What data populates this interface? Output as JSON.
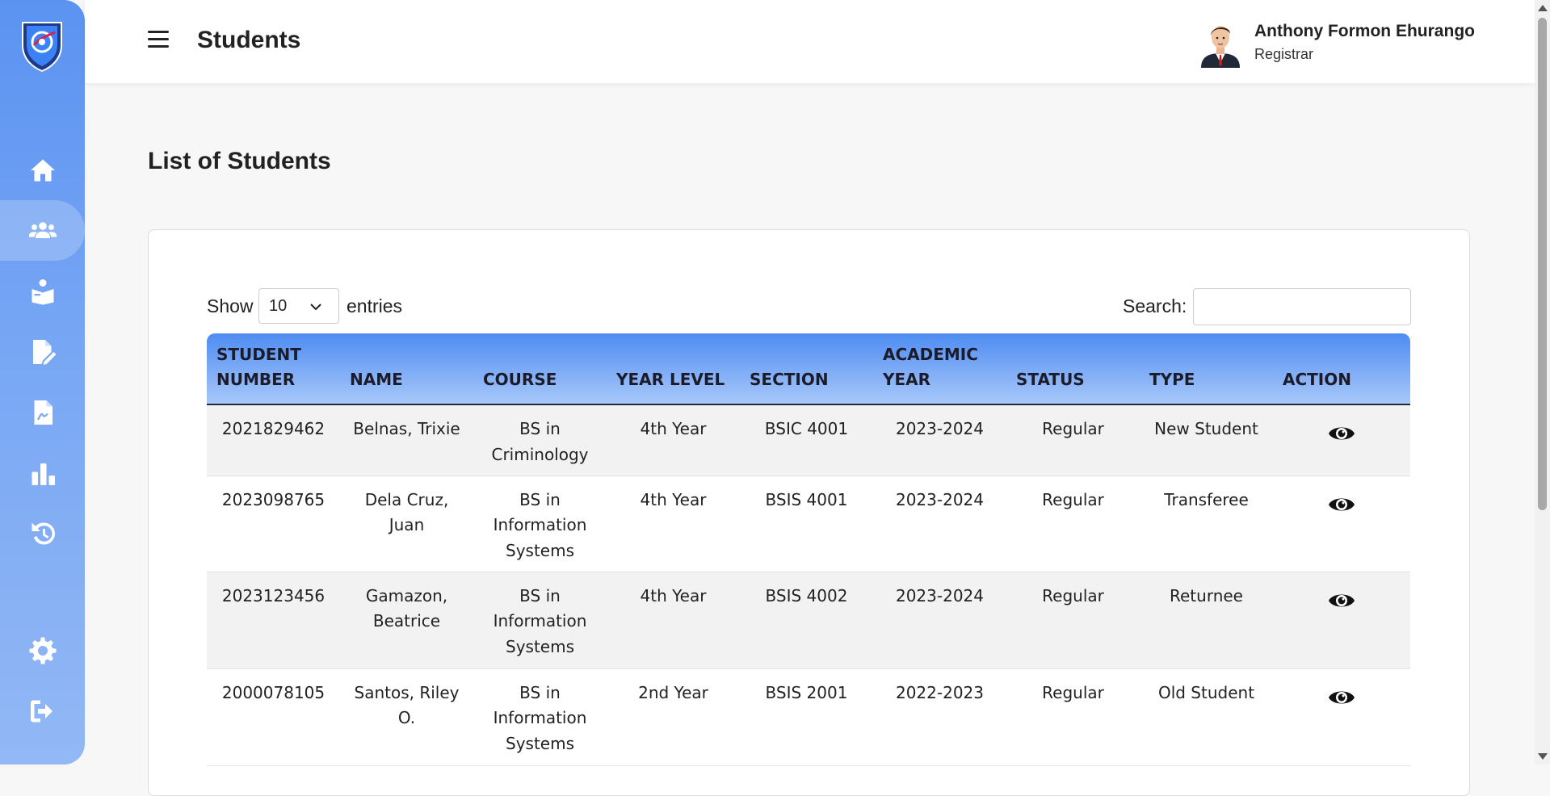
{
  "header": {
    "title": "Students",
    "user_name": "Anthony Formon Ehurango",
    "user_role": "Registrar"
  },
  "sidebar": {
    "items": [
      {
        "icon": "home-icon",
        "active": false
      },
      {
        "icon": "users-icon",
        "active": true
      },
      {
        "icon": "student-reading-icon",
        "active": false
      },
      {
        "icon": "file-edit-icon",
        "active": false
      },
      {
        "icon": "file-signature-icon",
        "active": false
      },
      {
        "icon": "bar-chart-icon",
        "active": false
      },
      {
        "icon": "history-icon",
        "active": false
      },
      {
        "icon": "gear-icon",
        "active": false
      },
      {
        "icon": "logout-icon",
        "active": false
      }
    ]
  },
  "main": {
    "section_title": "List of Students",
    "show_label": "Show",
    "entries_value": "10",
    "entries_label": "entries",
    "search_label": "Search:",
    "search_value": ""
  },
  "table": {
    "headers": [
      "STUDENT NUMBER",
      "NAME",
      "COURSE",
      "YEAR LEVEL",
      "SECTION",
      "ACADEMIC YEAR",
      "STATUS",
      "TYPE",
      "ACTION"
    ],
    "rows": [
      {
        "student_number": "2021829462",
        "name": "Belnas, Trixie",
        "course": "BS in Criminology",
        "year_level": "4th Year",
        "section": "BSIC 4001",
        "academic_year": "2023-2024",
        "status": "Regular",
        "type": "New Student"
      },
      {
        "student_number": "2023098765",
        "name": "Dela Cruz, Juan",
        "course": "BS in Information Systems",
        "year_level": "4th Year",
        "section": "BSIS 4001",
        "academic_year": "2023-2024",
        "status": "Regular",
        "type": "Transferee"
      },
      {
        "student_number": "2023123456",
        "name": "Gamazon, Beatrice",
        "course": "BS in Information Systems",
        "year_level": "4th Year",
        "section": "BSIS 4002",
        "academic_year": "2023-2024",
        "status": "Regular",
        "type": "Returnee"
      },
      {
        "student_number": "2000078105",
        "name": "Santos, Riley O.",
        "course": "BS in Information Systems",
        "year_level": "2nd Year",
        "section": "BSIS 2001",
        "academic_year": "2022-2023",
        "status": "Regular",
        "type": "Old Student"
      }
    ]
  },
  "colors": {
    "sidebar_top": "#5b93f2",
    "sidebar_bottom": "#92b8f5",
    "table_header_top": "#4e8cf2",
    "table_header_bottom": "#a9c8f9"
  }
}
